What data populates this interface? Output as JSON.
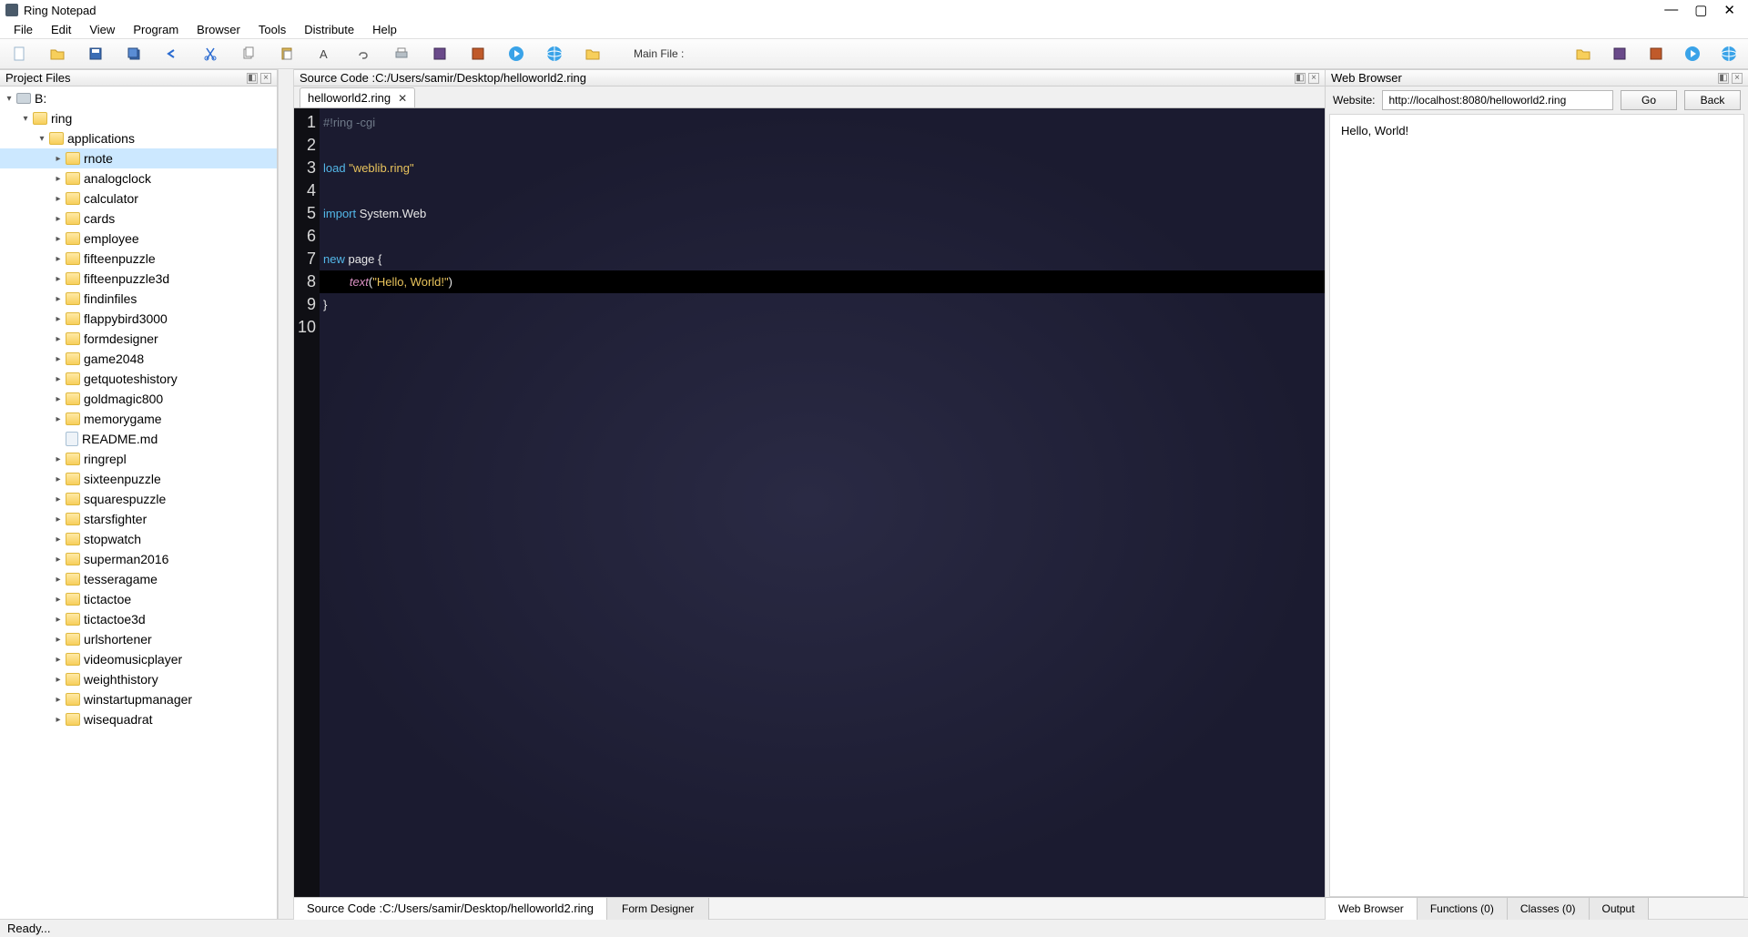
{
  "window": {
    "title": "Ring Notepad"
  },
  "menus": [
    "File",
    "Edit",
    "View",
    "Program",
    "Browser",
    "Tools",
    "Distribute",
    "Help"
  ],
  "toolbar": {
    "main_file_label": "Main File :"
  },
  "project": {
    "panel_title": "Project Files",
    "drive": "B:",
    "root": "ring",
    "applications_label": "applications",
    "items": [
      "rnote",
      "analogclock",
      "calculator",
      "cards",
      "employee",
      "fifteenpuzzle",
      "fifteenpuzzle3d",
      "findinfiles",
      "flappybird3000",
      "formdesigner",
      "game2048",
      "getquoteshistory",
      "goldmagic800",
      "memorygame",
      "README.md",
      "ringrepl",
      "sixteenpuzzle",
      "squarespuzzle",
      "starsfighter",
      "stopwatch",
      "superman2016",
      "tesseragame",
      "tictactoe",
      "tictactoe3d",
      "urlshortener",
      "videomusicplayer",
      "weighthistory",
      "winstartupmanager",
      "wisequadrat"
    ]
  },
  "editor": {
    "header_prefix": "Source Code : ",
    "file_path": "C:/Users/samir/Desktop/helloworld2.ring",
    "tab_label": "helloworld2.ring",
    "line_numbers": [
      "1",
      "2",
      "3",
      "4",
      "5",
      "6",
      "7",
      "8",
      "9",
      "10"
    ],
    "bottom_tabs": {
      "source_prefix": "Source Code : ",
      "form_designer": "Form Designer"
    }
  },
  "code": {
    "l1_shebang": "#!ring -cgi",
    "l3_kw": "load ",
    "l3_str": "\"weblib.ring\"",
    "l5_kw": "import ",
    "l5_rest": "System.Web",
    "l7_kw": "new ",
    "l7_rest": "page {",
    "l8_pad": "        ",
    "l8_fn": "text",
    "l8_open": "(",
    "l8_str": "\"Hello, World!\"",
    "l8_close": ")",
    "l9": "}"
  },
  "browser": {
    "panel_title": "Web Browser",
    "url_label": "Website:",
    "url": "http://localhost:8080/helloworld2.ring",
    "go_label": "Go",
    "back_label": "Back",
    "content": "Hello, World!",
    "bottom_tabs": [
      "Web Browser",
      "Functions (0)",
      "Classes (0)",
      "Output"
    ]
  },
  "status": {
    "text": "Ready..."
  }
}
